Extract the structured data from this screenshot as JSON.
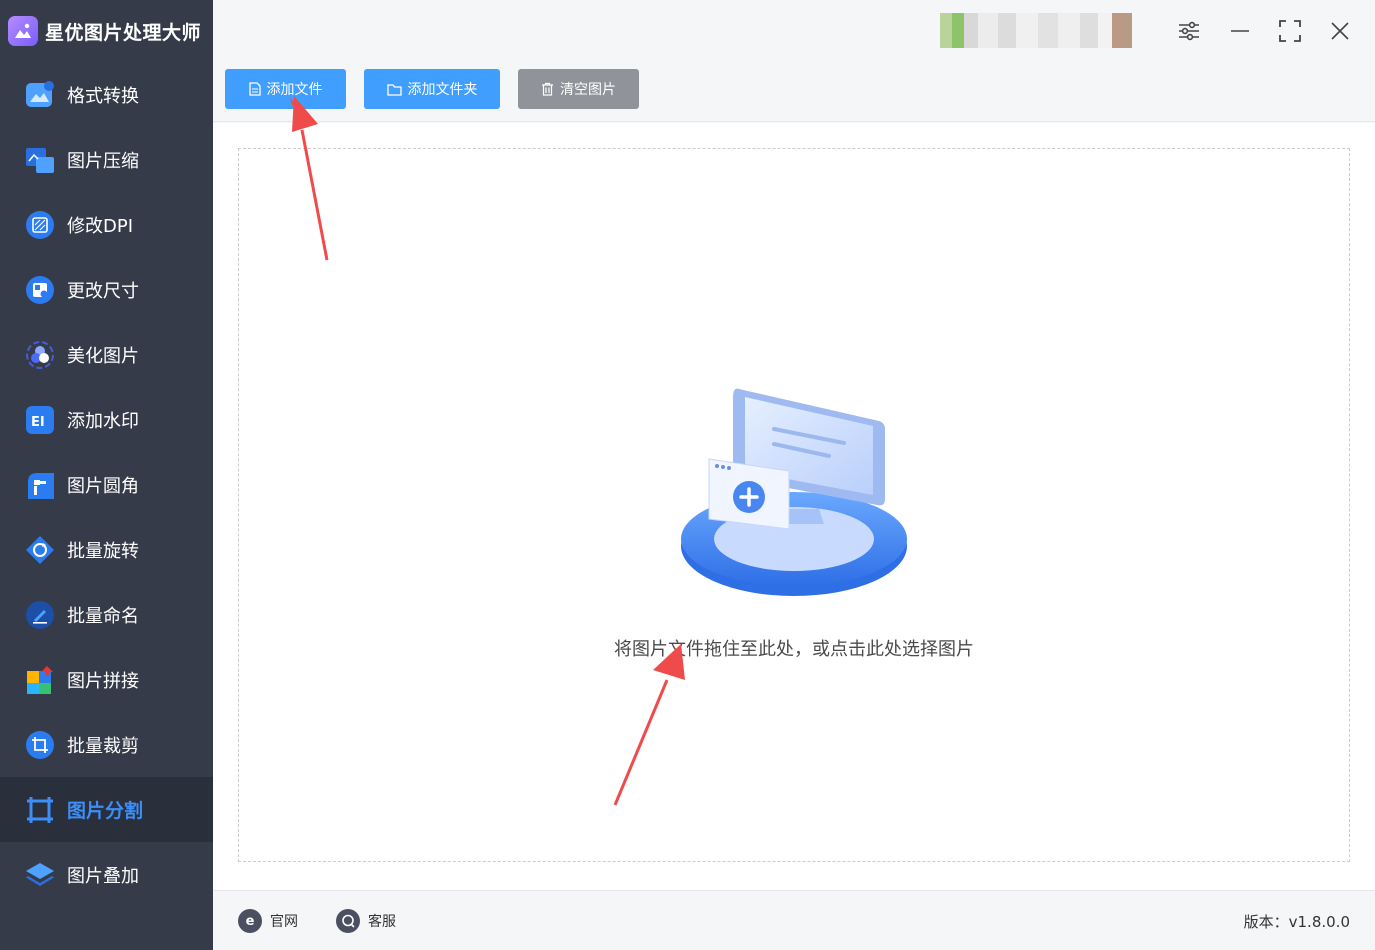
{
  "app": {
    "title": "星优图片处理大师"
  },
  "sidebar": {
    "items": [
      {
        "label": "格式转换",
        "icon": "image-convert-icon"
      },
      {
        "label": "图片压缩",
        "icon": "image-compress-icon"
      },
      {
        "label": "修改DPI",
        "icon": "dpi-icon"
      },
      {
        "label": "更改尺寸",
        "icon": "resize-icon"
      },
      {
        "label": "美化图片",
        "icon": "beautify-icon"
      },
      {
        "label": "添加水印",
        "icon": "watermark-icon"
      },
      {
        "label": "图片圆角",
        "icon": "round-corner-icon"
      },
      {
        "label": "批量旋转",
        "icon": "rotate-icon"
      },
      {
        "label": "批量命名",
        "icon": "rename-icon"
      },
      {
        "label": "图片拼接",
        "icon": "puzzle-icon"
      },
      {
        "label": "批量裁剪",
        "icon": "crop-icon"
      },
      {
        "label": "图片分割",
        "icon": "split-icon",
        "active": true
      },
      {
        "label": "图片叠加",
        "icon": "layers-icon"
      }
    ]
  },
  "toolbar": {
    "add_file": "添加文件",
    "add_folder": "添加文件夹",
    "clear": "清空图片"
  },
  "dropzone": {
    "hint": "将图片文件拖住至此处，或点击此处选择图片"
  },
  "footer": {
    "website": "官网",
    "support": "客服",
    "version": "版本：v1.8.0.0"
  },
  "colors": {
    "sidebar_bg": "#363b4a",
    "accent": "#3c8ef8",
    "primary_button": "#409eff",
    "clear_button": "#909399",
    "annotation_arrow": "#f04b4b"
  }
}
